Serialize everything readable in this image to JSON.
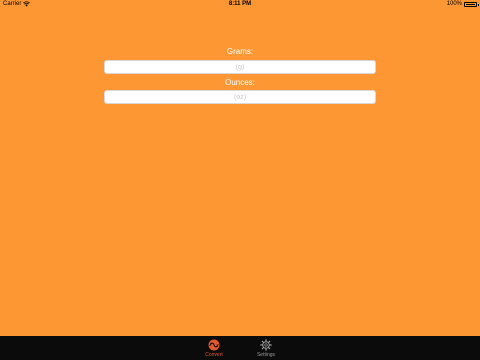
{
  "status_bar": {
    "carrier": "Carrier",
    "time": "8:11 PM",
    "battery_percent": "100%",
    "battery_level": 1.0
  },
  "form": {
    "grams": {
      "label": "Grams:",
      "value": "",
      "placeholder": "(g)"
    },
    "ounces": {
      "label": "Ounces:",
      "value": "",
      "placeholder": "(oz)"
    }
  },
  "tab_bar": {
    "tabs": [
      {
        "label": "Convert",
        "icon": "convert-icon",
        "selected": true
      },
      {
        "label": "Settings",
        "icon": "gear-icon",
        "selected": false
      }
    ]
  },
  "colors": {
    "background": "#FC9733",
    "tab_bar_background": "#0B0B0B",
    "tab_selected": "#E1592E",
    "tab_unselected": "#9A9A9A",
    "label_text": "#FFFFFF",
    "field_background": "#FFFFFF"
  }
}
